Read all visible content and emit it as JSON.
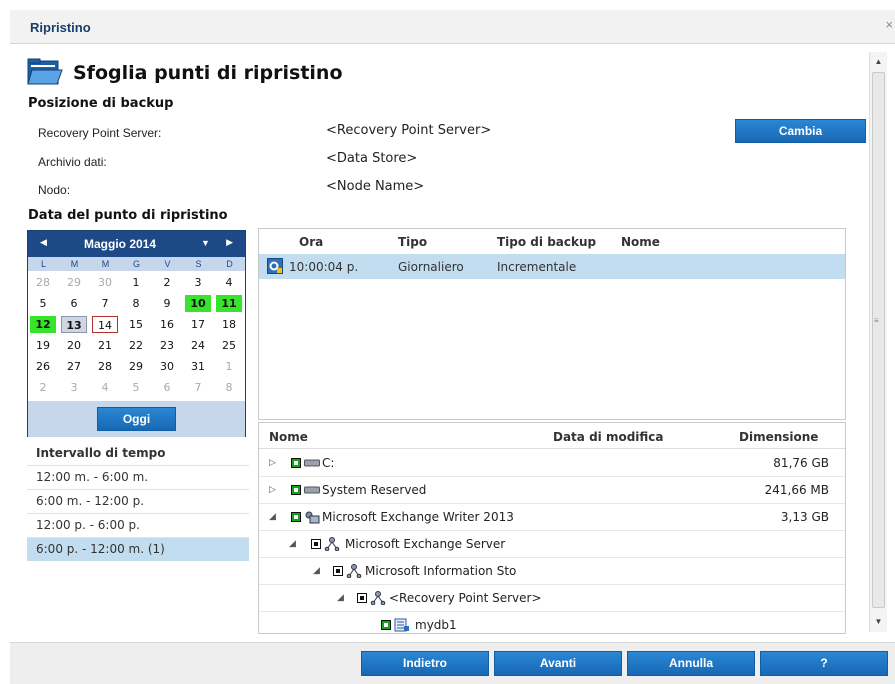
{
  "dialog": {
    "title": "Ripristino",
    "close": "×"
  },
  "header": {
    "title": "Sfoglia punti di ripristino",
    "icon": "folder-open-icon"
  },
  "backup_location": {
    "heading": "Posizione di backup",
    "fields": [
      {
        "label": "Recovery Point Server:",
        "value": "<Recovery Point Server>"
      },
      {
        "label": "Archivio dati:",
        "value": "<Data Store>"
      },
      {
        "label": "Nodo:",
        "value": "<Node Name>"
      }
    ],
    "change_button": "Cambia"
  },
  "recovery_date": {
    "heading": "Data del punto di ripristino",
    "calendar": {
      "month_label": "Maggio 2014",
      "weekdays": [
        "L",
        "M",
        "M",
        "G",
        "V",
        "S",
        "D"
      ],
      "weeks": [
        [
          "28",
          "29",
          "30",
          "1",
          "2",
          "3",
          "4"
        ],
        [
          "5",
          "6",
          "7",
          "8",
          "9",
          "10",
          "11"
        ],
        [
          "12",
          "13",
          "14",
          "15",
          "16",
          "17",
          "18"
        ],
        [
          "19",
          "20",
          "21",
          "22",
          "23",
          "24",
          "25"
        ],
        [
          "26",
          "27",
          "28",
          "29",
          "30",
          "31",
          "1"
        ],
        [
          "2",
          "3",
          "4",
          "5",
          "6",
          "7",
          "8"
        ]
      ],
      "today_button": "Oggi"
    }
  },
  "time_interval": {
    "heading": "Intervallo di tempo",
    "items": [
      "12:00 m. - 6:00 m.",
      "6:00 m. - 12:00 p.",
      "12:00 p. - 6:00 p.",
      "6:00 p. - 12:00 m.  (1)"
    ]
  },
  "recovery_points": {
    "columns": [
      "Ora",
      "Tipo",
      "Tipo di backup",
      "Nome"
    ],
    "rows": [
      {
        "time": "10:00:04 p.",
        "type": "Giornaliero",
        "backup_type": "Incrementale",
        "name": ""
      }
    ]
  },
  "file_tree": {
    "columns": [
      "Nome",
      "Data di modifica",
      "Dimensione"
    ],
    "rows": [
      {
        "name": "C:",
        "size": "81,76 GB"
      },
      {
        "name": "System Reserved",
        "size": "241,66 MB"
      },
      {
        "name": "Microsoft Exchange Writer 2013",
        "size": "3,13 GB"
      },
      {
        "name": "Microsoft Exchange Server",
        "size": ""
      },
      {
        "name": "Microsoft Information Sto",
        "size": ""
      },
      {
        "name": "<Recovery Point Server>",
        "size": ""
      },
      {
        "name": "mydb1",
        "size": ""
      }
    ]
  },
  "footer": {
    "back": "Indietro",
    "next": "Avanti",
    "cancel": "Annulla",
    "help": "?"
  },
  "colors": {
    "accent": "#1768b4",
    "highlight_day": "#36e52a",
    "selection": "#c2dcf0",
    "calendar_header": "#1d4a86"
  }
}
